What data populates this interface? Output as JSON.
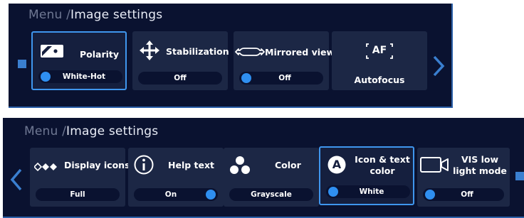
{
  "colors": {
    "panel_bg": "#0a1230",
    "card_bg": "#1c2745",
    "accent": "#2f8ff0",
    "selected_border": "#3f96ee"
  },
  "panels": [
    {
      "breadcrumb": {
        "root": "Menu /",
        "current": "Image settings"
      },
      "cards": [
        {
          "label": "Polarity",
          "icon": "polarity-icon",
          "value": "White-Hot",
          "toggle": "left",
          "selected": true
        },
        {
          "label": "Stabilization",
          "icon": "move-arrows-icon",
          "value": "Off",
          "toggle": "none",
          "selected": false
        },
        {
          "label": "Mirrored view",
          "icon": "mirror-icon",
          "value": "Off",
          "toggle": "left",
          "selected": false
        },
        {
          "label": "Autofocus",
          "icon": "autofocus-icon",
          "icon_text": "AF",
          "selected": false
        }
      ]
    },
    {
      "breadcrumb": {
        "root": "Menu /",
        "current": "Image settings"
      },
      "cards": [
        {
          "label": "Display icons",
          "icon": "display-icons-icon",
          "value": "Full",
          "toggle": "none",
          "selected": false
        },
        {
          "label": "Help text",
          "icon": "info-icon",
          "value": "On",
          "toggle": "right",
          "selected": false
        },
        {
          "label": "Color",
          "icon": "color-dots-icon",
          "value": "Grayscale",
          "toggle": "none",
          "selected": false
        },
        {
          "label": "Icon & text color",
          "icon": "a-circle-icon",
          "icon_text": "A",
          "value": "White",
          "toggle": "left",
          "selected": true
        },
        {
          "label": "VIS low light mode",
          "icon": "camera-icon",
          "value": "Off",
          "toggle": "left",
          "selected": false
        }
      ]
    }
  ]
}
